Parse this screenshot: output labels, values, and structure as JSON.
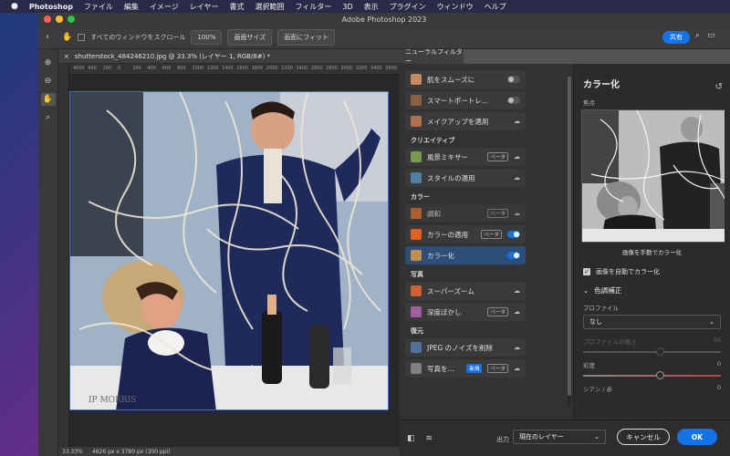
{
  "menubar": {
    "apple": "",
    "app": "Photoshop",
    "items": [
      "ファイル",
      "編集",
      "イメージ",
      "レイヤー",
      "書式",
      "選択範囲",
      "フィルター",
      "3D",
      "表示",
      "プラグイン",
      "ウィンドウ",
      "ヘルプ"
    ]
  },
  "window": {
    "title": "Adobe Photoshop 2023"
  },
  "options": {
    "scroll_all_label": "すべてのウィンドウをスクロール",
    "zoom_value": "100%",
    "fit_screen": "画面サイズ",
    "fill_screen": "画面にフィット",
    "share": "共有"
  },
  "document": {
    "tab_title": "shutterstock_484246210.jpg @ 33.3% (レイヤー 1, RGB/8#) *",
    "ruler_ticks": [
      "4600",
      "400",
      "200",
      "0",
      "200",
      "400",
      "600",
      "800",
      "1000",
      "1200",
      "1400",
      "1600",
      "1800",
      "2000",
      "2200",
      "2400",
      "2600",
      "2800",
      "3000",
      "3200",
      "3400",
      "3600"
    ],
    "zoom": "33.33%",
    "size_info": "4626 px x 3780 px (300 ppi)"
  },
  "neural": {
    "tab_label": "ニューラルフィルター",
    "categories": [
      {
        "name": "",
        "items": [
          {
            "label": "肌をスムーズに",
            "control": "toggle-off",
            "thumb": "#c88a60"
          },
          {
            "label": "スマートポートレ…",
            "control": "toggle-off",
            "thumb": "#8a6040"
          },
          {
            "label": "メイクアップを適用",
            "control": "cloud",
            "thumb": "#b07050"
          }
        ]
      },
      {
        "name": "クリエイティブ",
        "items": [
          {
            "label": "風景ミキサー",
            "badge": "ベータ",
            "control": "cloud",
            "thumb": "#7a9a50"
          },
          {
            "label": "スタイルの適用",
            "control": "cloud",
            "thumb": "#5080a0"
          }
        ]
      },
      {
        "name": "カラー",
        "items": [
          {
            "label": "調和",
            "badge": "ベータ",
            "control": "cloud",
            "thumb": "#d07030",
            "dim": true
          },
          {
            "label": "カラーの適用",
            "badge": "ベータ",
            "control": "toggle-on",
            "thumb": "#e06020"
          },
          {
            "label": "カラー化",
            "control": "toggle-on",
            "thumb": "#c09050",
            "selected": true
          }
        ]
      },
      {
        "name": "写真",
        "items": [
          {
            "label": "スーパーズーム",
            "control": "cloud",
            "thumb": "#d06030"
          },
          {
            "label": "深度ぼかし",
            "badge": "ベータ",
            "control": "cloud",
            "thumb": "#a060a0"
          }
        ]
      },
      {
        "name": "復元",
        "items": [
          {
            "label": "JPEG のノイズを削除",
            "control": "cloud",
            "thumb": "#5070a0"
          },
          {
            "label": "写真を…",
            "badge_new": "新規",
            "badge": "ベータ",
            "control": "cloud",
            "thumb": "#808080"
          }
        ]
      }
    ],
    "settings": {
      "title": "カラー化",
      "focus_label": "焦点",
      "manual_button": "画像を手動でカラー化",
      "auto_label": "画像を自動でカラー化",
      "color_section": "色調補正",
      "profile_label": "プロファイル",
      "profile_value": "なし",
      "profile_strength_label": "プロファイルの強さ",
      "profile_strength_value": "50",
      "saturation_label": "彩度",
      "saturation_value": "0",
      "cyan_red_label": "シアン / 赤",
      "cyan_red_value": "0"
    },
    "output_label": "出力",
    "output_value": "現在のレイヤー",
    "cancel": "キャンセル",
    "ok": "OK"
  },
  "colors": {
    "accent": "#1473e6",
    "panel": "#323232",
    "selected": "#2d4e78"
  }
}
